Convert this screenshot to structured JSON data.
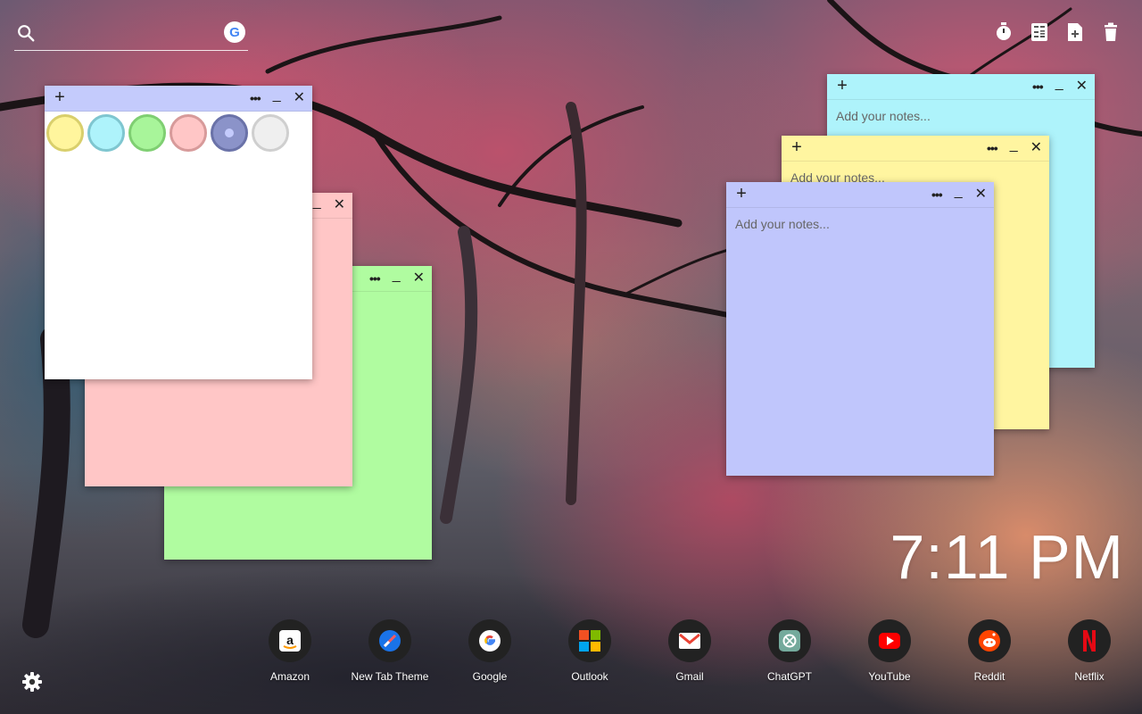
{
  "search": {
    "placeholder": "",
    "engine_badge": "G"
  },
  "top_tools": [
    {
      "name": "timer-icon"
    },
    {
      "name": "calculator-icon"
    },
    {
      "name": "note-add-icon"
    },
    {
      "name": "trash-icon"
    }
  ],
  "notes": {
    "placeholder": "Add your notes...",
    "add_label": "+",
    "more_label": "•••",
    "minimize_label": "_",
    "close_label": "✕"
  },
  "palette": [
    {
      "name": "yellow",
      "fill": "#fff59d",
      "ring": "#d9cf6c"
    },
    {
      "name": "cyan",
      "fill": "#aef3fb",
      "ring": "#7fc6d0"
    },
    {
      "name": "green",
      "fill": "#a8f59a",
      "ring": "#7fcf72"
    },
    {
      "name": "pink",
      "fill": "#ffc6c6",
      "ring": "#d79a9a"
    },
    {
      "name": "blue",
      "fill": "#8b93c9",
      "ring": "#6a72a8"
    },
    {
      "name": "white",
      "fill": "#efefef",
      "ring": "#cfcfcf"
    }
  ],
  "clock": {
    "time": "7:11 PM"
  },
  "dock": [
    {
      "label": "Amazon",
      "icon": "amazon-icon"
    },
    {
      "label": "New Tab Theme",
      "icon": "new-tab-theme-icon"
    },
    {
      "label": "Google",
      "icon": "google-icon"
    },
    {
      "label": "Outlook",
      "icon": "outlook-icon"
    },
    {
      "label": "Gmail",
      "icon": "gmail-icon"
    },
    {
      "label": "ChatGPT",
      "icon": "chatgpt-icon"
    },
    {
      "label": "YouTube",
      "icon": "youtube-icon"
    },
    {
      "label": "Reddit",
      "icon": "reddit-icon"
    },
    {
      "label": "Netflix",
      "icon": "netflix-icon"
    }
  ],
  "colors": {
    "note_green": "#b0fca0",
    "note_pink": "#ffc6c6",
    "note_white": "#ffffff",
    "note_cyan": "#aef3fb",
    "note_yellow": "#fff5a0",
    "note_blue": "#c0c6fc"
  }
}
